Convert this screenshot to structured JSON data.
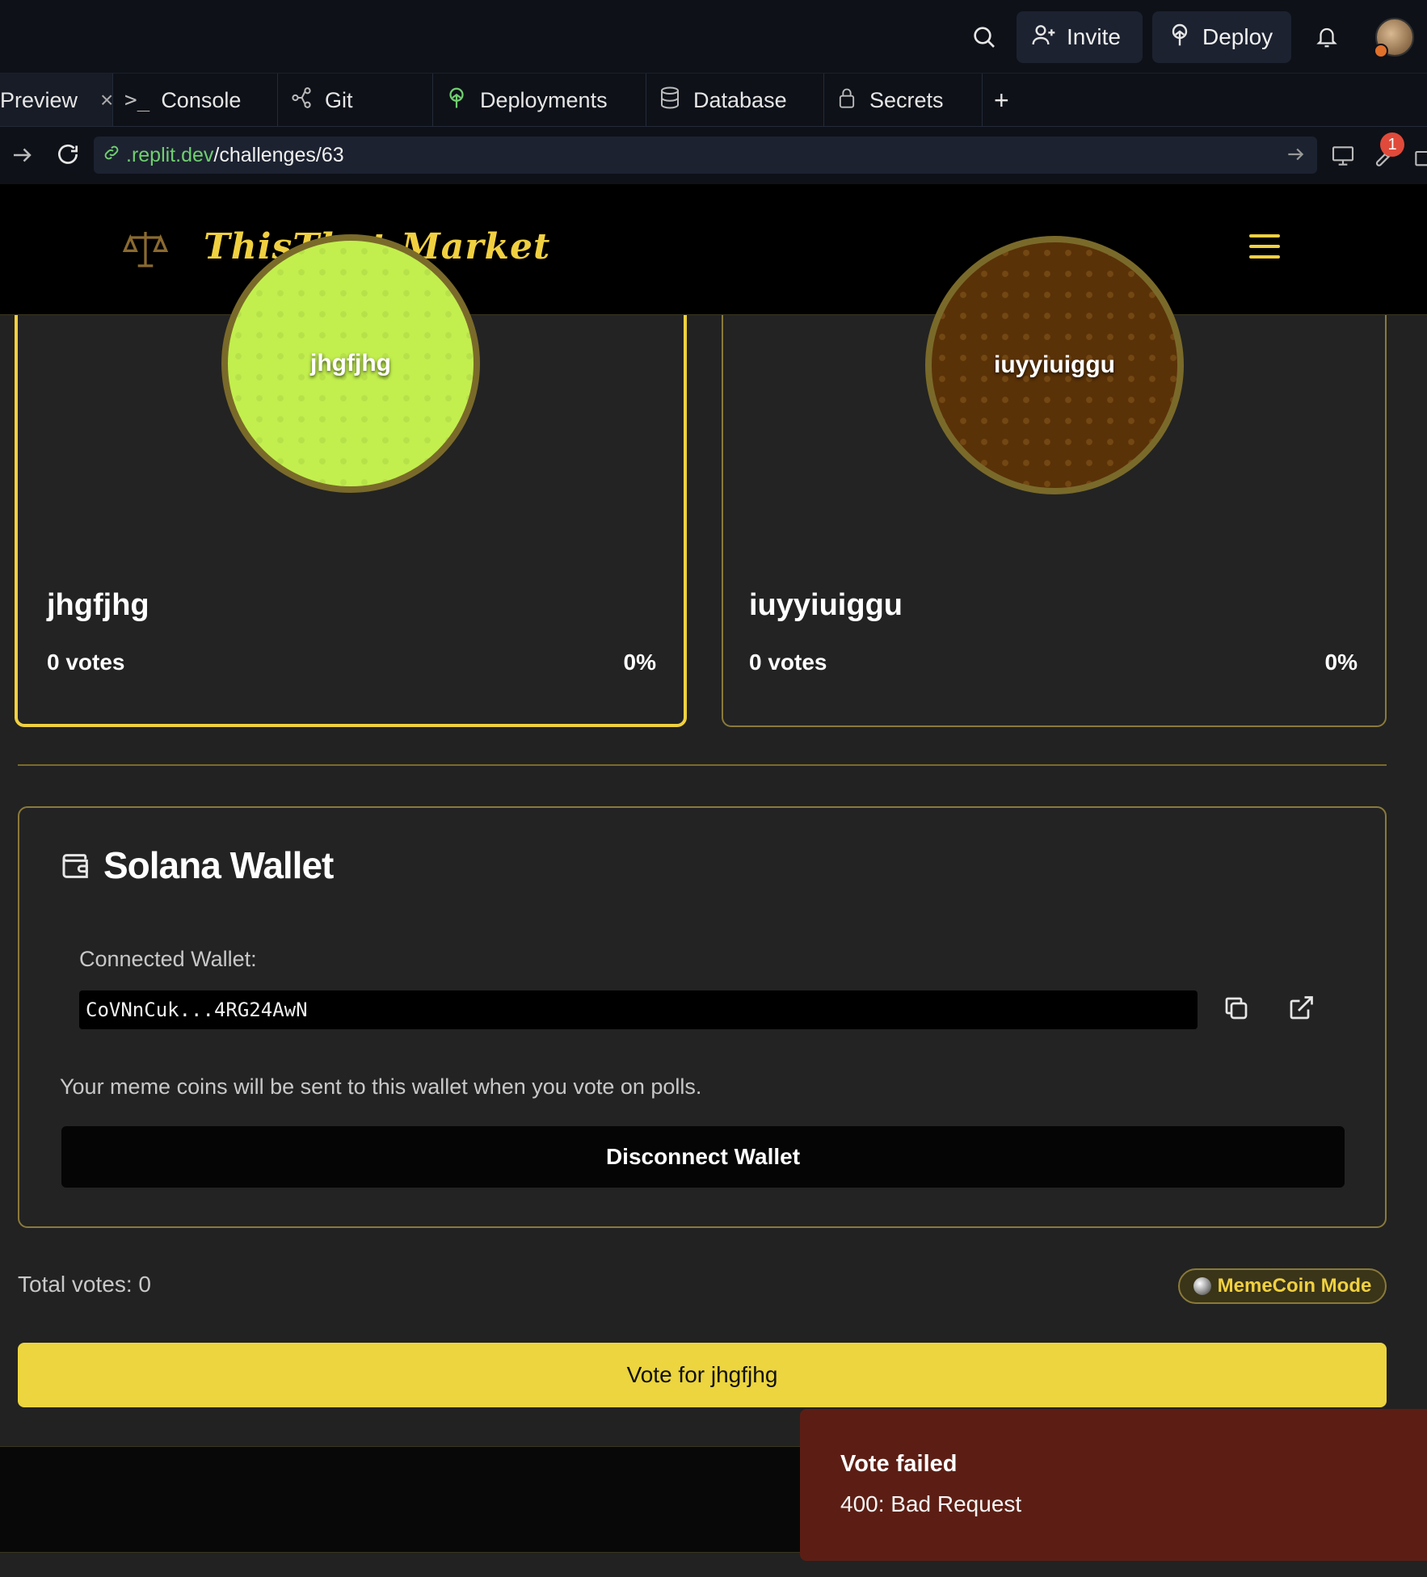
{
  "ide": {
    "invite_label": "Invite",
    "deploy_label": "Deploy",
    "notification_count": "1",
    "tabs": [
      {
        "label": "Preview",
        "close": "×"
      },
      {
        "label": "Console"
      },
      {
        "label": "Git"
      },
      {
        "label": "Deployments"
      },
      {
        "label": "Database"
      },
      {
        "label": "Secrets"
      },
      {
        "label": "+"
      }
    ],
    "url_domain": ".replit.dev",
    "url_path": "/challenges/63"
  },
  "site": {
    "logo_text": "ThisThat.Market"
  },
  "options": [
    {
      "circle_label": "jhgfjhg",
      "name": "jhgfjhg",
      "votes": "0 votes",
      "percent": "0%",
      "color": "#c2ef4e",
      "selected": true
    },
    {
      "circle_label": "iuyyiuiggu",
      "name": "iuyyiuiggu",
      "votes": "0 votes",
      "percent": "0%",
      "color": "#5a3208",
      "selected": false
    }
  ],
  "wallet": {
    "title": "Solana Wallet",
    "connected_label": "Connected Wallet:",
    "address": "CoVNnCuk...4RG24AwN",
    "note": "Your meme coins will be sent to this wallet when you vote on polls.",
    "disconnect_label": "Disconnect Wallet"
  },
  "poll": {
    "total_votes": "Total votes: 0",
    "mode_badge": "MemeCoin Mode",
    "vote_button": "Vote for jhgfjhg"
  },
  "toast": {
    "title": "Vote failed",
    "message": "400: Bad Request"
  },
  "colors": {
    "accent": "#ecd53e",
    "background": "#222222",
    "toast_bg": "#5c1e14"
  }
}
